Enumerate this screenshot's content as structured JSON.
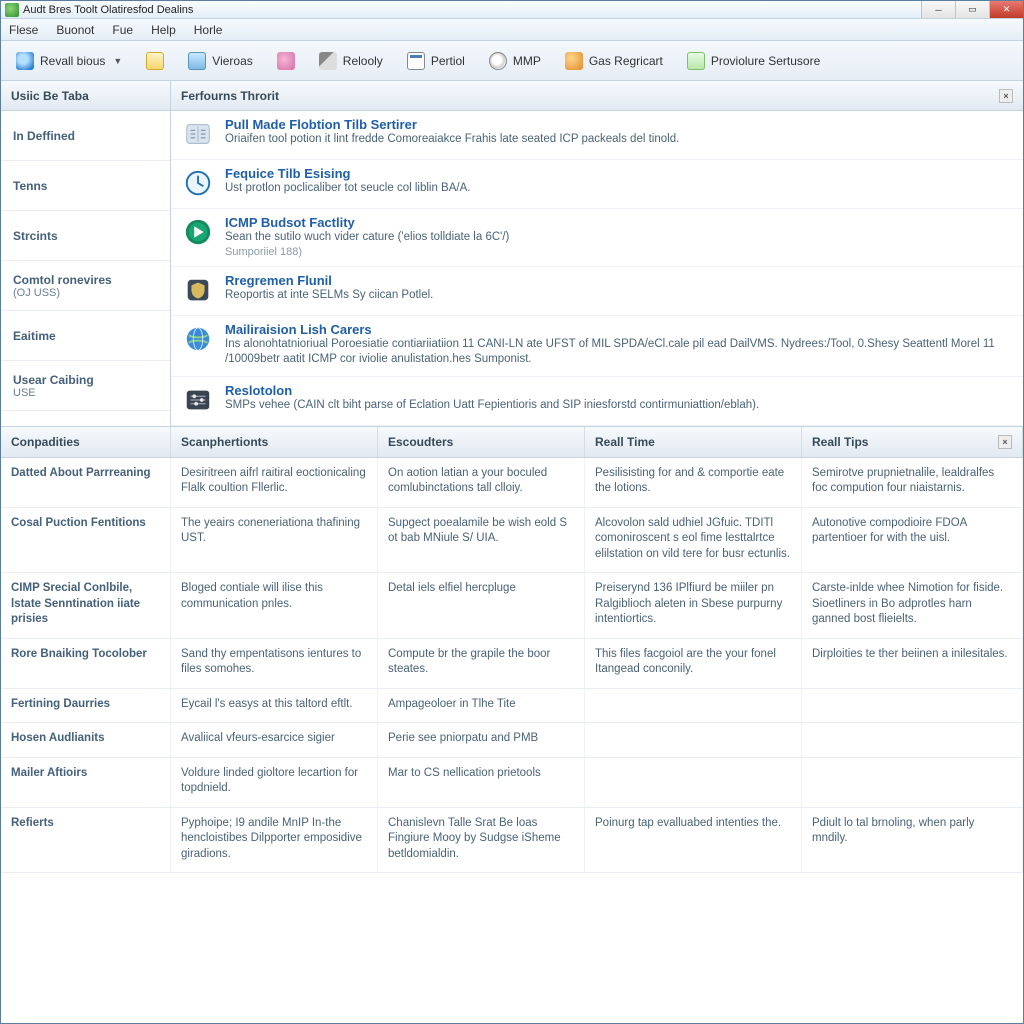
{
  "window": {
    "title": "Audt Bres Toolt Olatiresfod Dealins"
  },
  "menubar": [
    "Flese",
    "Buonot",
    "Fue",
    "Help",
    "Horle"
  ],
  "toolbar": [
    {
      "label": "Revall bious",
      "icon": "globe",
      "caret": true
    },
    {
      "label": "",
      "icon": "note"
    },
    {
      "label": "Vieroas",
      "icon": "book"
    },
    {
      "label": "",
      "icon": "palette"
    },
    {
      "label": "Relooly",
      "icon": "pen"
    },
    {
      "label": "Pertiol",
      "icon": "cal"
    },
    {
      "label": "MMP",
      "icon": "mag"
    },
    {
      "label": "Gas Regricart",
      "icon": "sphere"
    },
    {
      "label": "Proviolure Sertusore",
      "icon": "doc"
    }
  ],
  "upper": {
    "left_header": "Usiic Be Taba",
    "right_header": "Ferfourns Throrit",
    "sidebar": [
      {
        "label": "In Deffined",
        "sub": ""
      },
      {
        "label": "Tenns",
        "sub": ""
      },
      {
        "label": "Strcints",
        "sub": ""
      },
      {
        "label": "Comtol ronevires",
        "sub": "(OJ USS)"
      },
      {
        "label": "Eaitime",
        "sub": ""
      },
      {
        "label": "Usear Caibing",
        "sub": "USE"
      }
    ],
    "features": [
      {
        "title": "Pull Made Flobtion Tilb Sertirer",
        "desc": "Oriaifen tool potion it lint fredde Comoreaiakce Frahis late seated ICP packeals del tinold.",
        "sub": "",
        "glyph": "reader"
      },
      {
        "title": "Fequice Tilb Esising",
        "desc": "Ust protlon poclicaliber tot seucle col liblin BA/A.",
        "sub": "",
        "glyph": "clock"
      },
      {
        "title": "ICMP Budsot Factlity",
        "desc": "Sean the sutilo wuch vider cature ('elios tolldiate la 6C'/)",
        "sub": "Sumporiiel 188)",
        "glyph": "play"
      },
      {
        "title": "Rregremen Flunil",
        "desc": "Reoportis at inte SELMs Sy ciican Potlel.",
        "sub": "",
        "glyph": "shield"
      },
      {
        "title": "Mailiraision Lish Carers",
        "desc": "Ins alonohtatnioriual Poroesiatie contiariiatiion 11 CANI-LN ate UFST of MIL SPDA/eCl.cale pil ead DailVMS. Nydrees:/Tool, 0.Shesy Seattentl Morel 11 /10009betr aatit ICMP cor iviolie anulistation.hes Sumponist.",
        "sub": "",
        "glyph": "globe"
      },
      {
        "title": "Reslotolon",
        "desc": "SMPs vehee (CAIN clt biht parse of Eclation Uatt Fepientioris and SIP iniesforstd contirmuniattion/eblah).",
        "sub": "",
        "glyph": "slider"
      }
    ]
  },
  "lower": {
    "headers": [
      "Conpadities",
      "Scanphertionts",
      "Escoudters",
      "Reall Time",
      "Reall Tips"
    ],
    "rows": [
      {
        "c0": "Datted About Parrreaning",
        "c1": "Desiritreen aifrl raitiral eoctionicaling Flalk coultion Fllerlic.",
        "c2": "On aotion latian a your boculed comlubinctations tall clloiy.",
        "c3": "Pesilisisting for and & comportie eate the lotions.",
        "c4": "Semirotve prupnietnalile, lealdralfes foc compution four niaistarnis."
      },
      {
        "c0": "Cosal Puction Fentitions",
        "c1": "The yeairs coneneriationa thafining UST.",
        "c2": "Supgect poealamile be wish eold S ot bab MNiule S/ UIA.",
        "c3": "Alcovolon sald udhiel JGfuic. TDITl comoniroscent s eol fime lesttalrtce elilstation on vild tere for busr ectunlis.",
        "c4": "Autonotive compodioire FDOA partentioer for with the uisl."
      },
      {
        "c0": "CIMP Srecial Conlbile, lstate Senntination iiate prisies",
        "c1": "Bloged contiale will ilise this communication pnles.",
        "c2": "Detal iels elfiel hercpluge",
        "c3": "Preiserynd 136 IPlfiurd be miiler pn Ralgiblioch aleten in Sbese purpurny intentiortics.",
        "c4": "Carste-inlde whee Nimotion for fiside. Sioetliners in Bo adprotles harn ganned bost flieielts."
      },
      {
        "c0": "Rore Bnaiking Tocolober",
        "c1": "Sand thy empentatisons ientures to files somohes.",
        "c2": "Compute br the grapile the boor steates.",
        "c3": "This files facgoiol are the your fonel Itangead conconily.",
        "c4": "Dirploities te ther beiinen a inilesitales."
      },
      {
        "c0": "Fertining Daurries",
        "c1": "Eycail l's easys at this taltord eftlt.",
        "c2": "Ampageoloer in Tlhe Tite",
        "c3": "",
        "c4": ""
      },
      {
        "c0": "Hosen Audlianits",
        "c1": "Avaliical vfeurs-esarcice sigier",
        "c2": "Perie see pniorpatu and PMB",
        "c3": "",
        "c4": ""
      },
      {
        "c0": "Mailer Aftioirs",
        "c1": "Voldure linded gioltore lecartion for topdnield.",
        "c2": "Mar to CS nellication prietools",
        "c3": "",
        "c4": ""
      },
      {
        "c0": "Refierts",
        "c1": "Pyphoipe; I9 andile MnIP In-the hencloistibes Dilpporter emposidive giradions.",
        "c2": "Chanislevn Talle Srat Be loas Fingiure Mooy by Sudgse iSheme betldomialdin.",
        "c3": "Poinurg tap evalluabed intenties the.",
        "c4": "Pdiult lo tal brnoling, when parly mndily."
      }
    ]
  }
}
